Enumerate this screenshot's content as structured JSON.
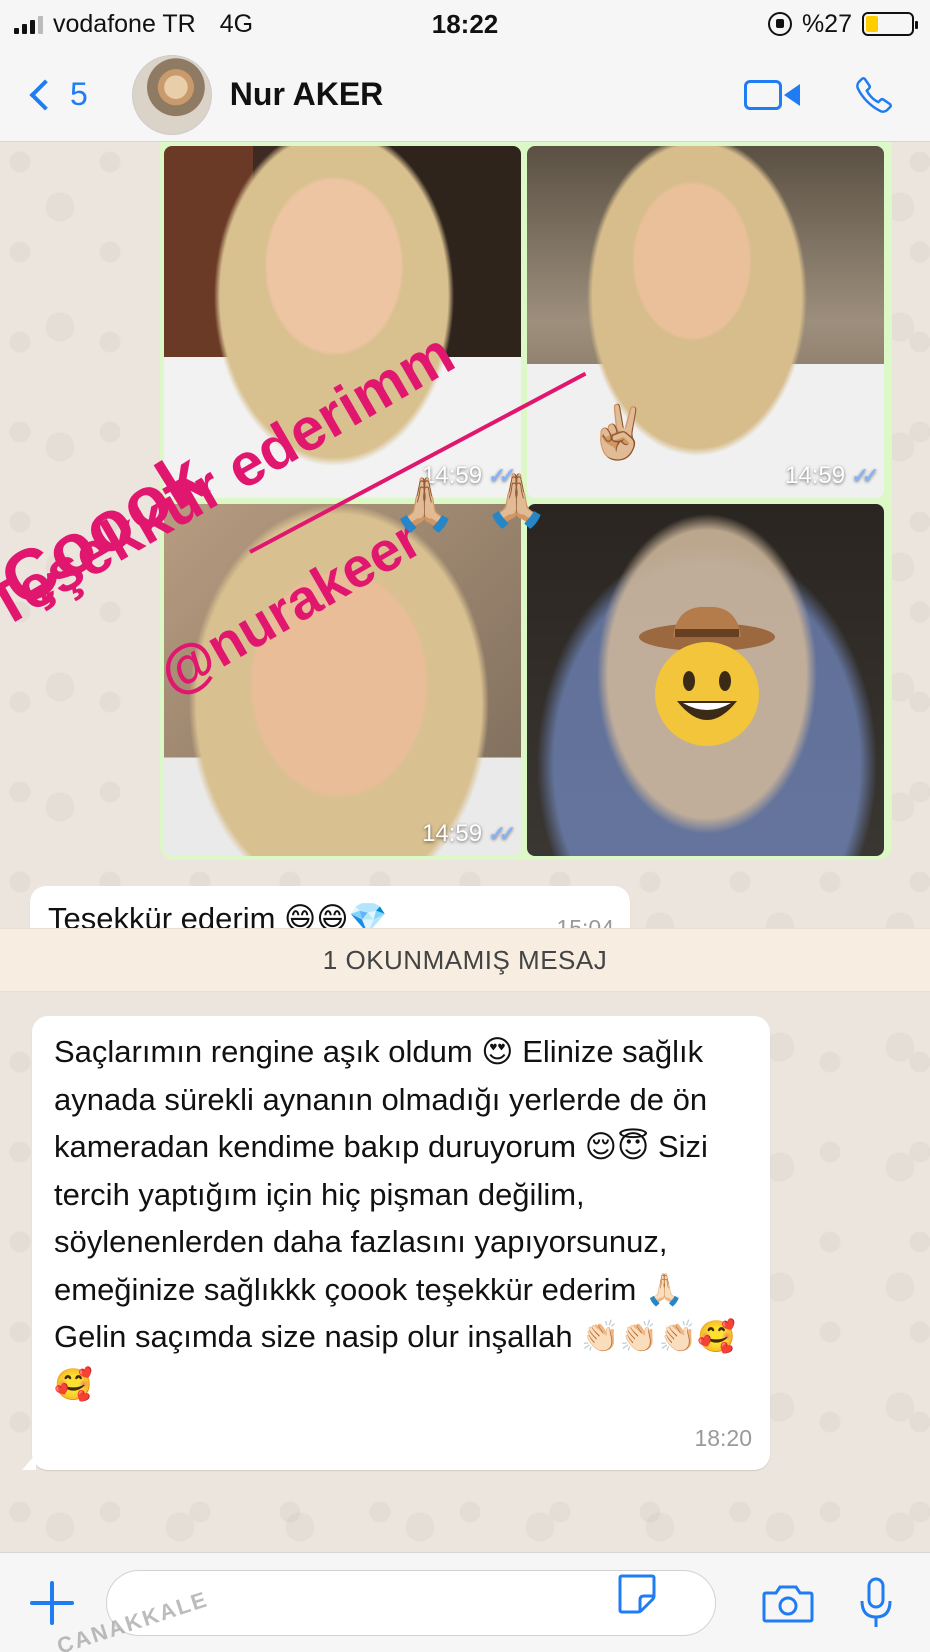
{
  "status_bar": {
    "carrier": "vodafone TR",
    "network": "4G",
    "time": "18:22",
    "battery_percent": "%27",
    "battery_level": 0.27
  },
  "header": {
    "back_count": "5",
    "contact_name": "Nur AKER",
    "icons": [
      "chevron-left-icon",
      "video-call-icon",
      "phone-icon"
    ]
  },
  "media_message": {
    "photos": [
      {
        "time": "14:59"
      },
      {
        "time": "14:59"
      },
      {
        "time": "14:59"
      },
      {
        "time": ""
      }
    ],
    "overlay": {
      "line1": "Çoook",
      "line2": "Teşekkür ederimm",
      "line3": "@nurakeer",
      "color": "#e0166f",
      "emojis": [
        "✌🏼",
        "🙏🏼",
        "🤠"
      ]
    }
  },
  "messages": [
    {
      "text": "Teşekkür ederim 😄😄💎",
      "time": "15:04"
    },
    {
      "text": "Saçlarımın rengine aşık oldum 😍 Elinize sağlık aynada sürekli aynanın olmadığı yerlerde de ön kameradan kendime bakıp duruyorum 😌😇 Sizi tercih yaptığım için hiç pişman değilim, söylenenlerden daha fazlasını yapıyorsunuz, emeğinize sağlıkkk çoook teşekkür ederim 🙏🏻 Gelin saçımda size nasip olur inşallah 👏🏻👏🏻👏🏻🥰🥰",
      "time": "18:20"
    }
  ],
  "unread_banner": "1 OKUNMAMIŞ MESAJ",
  "input_bar": {
    "placeholder": "",
    "watermark": "ÇANAKKALE",
    "icons": [
      "plus-icon",
      "sticker-icon",
      "camera-icon",
      "microphone-icon"
    ]
  },
  "colors": {
    "accent": "#1f7cf2",
    "outgoing_bubble": "#dcf8c6",
    "incoming_bubble": "#ffffff",
    "chat_background": "#ece5dd"
  }
}
